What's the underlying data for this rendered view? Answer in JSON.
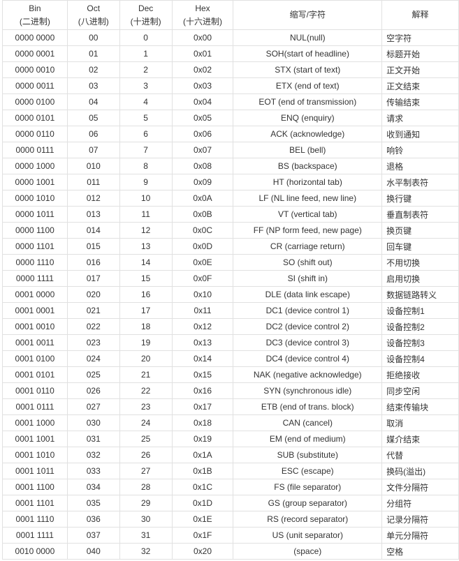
{
  "table": {
    "headers": [
      {
        "line1": "Bin",
        "line2": "(二进制)"
      },
      {
        "line1": "Oct",
        "line2": "(八进制)"
      },
      {
        "line1": "Dec",
        "line2": "(十进制)"
      },
      {
        "line1": "Hex",
        "line2": "(十六进制)"
      },
      {
        "line1": "缩写/字符",
        "line2": ""
      },
      {
        "line1": "解释",
        "line2": ""
      }
    ],
    "rows": [
      [
        "0000 0000",
        "00",
        "0",
        "0x00",
        "NUL(null)",
        "空字符"
      ],
      [
        "0000 0001",
        "01",
        "1",
        "0x01",
        "SOH(start of headline)",
        "标题开始"
      ],
      [
        "0000 0010",
        "02",
        "2",
        "0x02",
        "STX (start of text)",
        "正文开始"
      ],
      [
        "0000 0011",
        "03",
        "3",
        "0x03",
        "ETX (end of text)",
        "正文结束"
      ],
      [
        "0000 0100",
        "04",
        "4",
        "0x04",
        "EOT (end of transmission)",
        "传输结束"
      ],
      [
        "0000 0101",
        "05",
        "5",
        "0x05",
        "ENQ (enquiry)",
        "请求"
      ],
      [
        "0000 0110",
        "06",
        "6",
        "0x06",
        "ACK (acknowledge)",
        "收到通知"
      ],
      [
        "0000 0111",
        "07",
        "7",
        "0x07",
        "BEL (bell)",
        "响铃"
      ],
      [
        "0000 1000",
        "010",
        "8",
        "0x08",
        "BS (backspace)",
        "退格"
      ],
      [
        "0000 1001",
        "011",
        "9",
        "0x09",
        "HT (horizontal tab)",
        "水平制表符"
      ],
      [
        "0000 1010",
        "012",
        "10",
        "0x0A",
        "LF (NL line feed, new line)",
        "换行键"
      ],
      [
        "0000 1011",
        "013",
        "11",
        "0x0B",
        "VT (vertical tab)",
        "垂直制表符"
      ],
      [
        "0000 1100",
        "014",
        "12",
        "0x0C",
        "FF (NP form feed, new page)",
        "换页键"
      ],
      [
        "0000 1101",
        "015",
        "13",
        "0x0D",
        "CR (carriage return)",
        "回车键"
      ],
      [
        "0000 1110",
        "016",
        "14",
        "0x0E",
        "SO (shift out)",
        "不用切换"
      ],
      [
        "0000 1111",
        "017",
        "15",
        "0x0F",
        "SI (shift in)",
        "启用切换"
      ],
      [
        "0001 0000",
        "020",
        "16",
        "0x10",
        "DLE (data link escape)",
        "数据链路转义"
      ],
      [
        "0001 0001",
        "021",
        "17",
        "0x11",
        "DC1 (device control 1)",
        "设备控制1"
      ],
      [
        "0001 0010",
        "022",
        "18",
        "0x12",
        "DC2 (device control 2)",
        "设备控制2"
      ],
      [
        "0001 0011",
        "023",
        "19",
        "0x13",
        "DC3 (device control 3)",
        "设备控制3"
      ],
      [
        "0001 0100",
        "024",
        "20",
        "0x14",
        "DC4 (device control 4)",
        "设备控制4"
      ],
      [
        "0001 0101",
        "025",
        "21",
        "0x15",
        "NAK (negative acknowledge)",
        "拒绝接收"
      ],
      [
        "0001 0110",
        "026",
        "22",
        "0x16",
        "SYN (synchronous idle)",
        "同步空闲"
      ],
      [
        "0001 0111",
        "027",
        "23",
        "0x17",
        "ETB (end of trans. block)",
        "结束传输块"
      ],
      [
        "0001 1000",
        "030",
        "24",
        "0x18",
        "CAN (cancel)",
        "取消"
      ],
      [
        "0001 1001",
        "031",
        "25",
        "0x19",
        "EM (end of medium)",
        "媒介结束"
      ],
      [
        "0001 1010",
        "032",
        "26",
        "0x1A",
        "SUB (substitute)",
        "代替"
      ],
      [
        "0001 1011",
        "033",
        "27",
        "0x1B",
        "ESC (escape)",
        "换码(溢出)"
      ],
      [
        "0001 1100",
        "034",
        "28",
        "0x1C",
        "FS (file separator)",
        "文件分隔符"
      ],
      [
        "0001 1101",
        "035",
        "29",
        "0x1D",
        "GS (group separator)",
        "分组符"
      ],
      [
        "0001 1110",
        "036",
        "30",
        "0x1E",
        "RS (record separator)",
        "记录分隔符"
      ],
      [
        "0001 1111",
        "037",
        "31",
        "0x1F",
        "US (unit separator)",
        "单元分隔符"
      ],
      [
        "0010 0000",
        "040",
        "32",
        "0x20",
        "(space)",
        "空格"
      ]
    ]
  }
}
